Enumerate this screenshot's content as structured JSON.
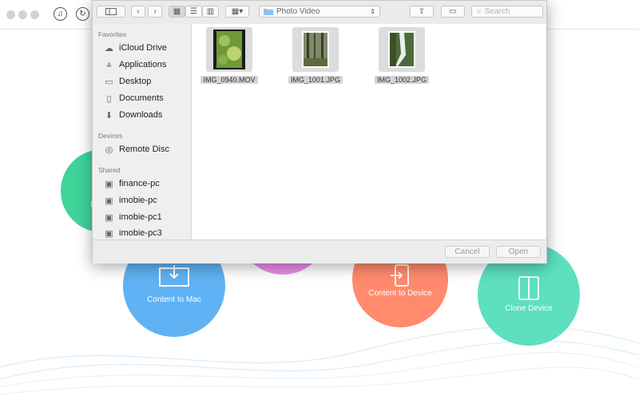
{
  "dialog": {
    "location": "Photo Video",
    "search_placeholder": "Search",
    "sections": {
      "favorites": "Favorites",
      "devices": "Devices",
      "shared": "Shared"
    },
    "favorites": [
      "iCloud Drive",
      "Applications",
      "Desktop",
      "Documents",
      "Downloads"
    ],
    "devices": [
      "Remote Disc"
    ],
    "shared": [
      "finance-pc",
      "imobie-pc",
      "imobie-pc1",
      "imobie-pc3"
    ],
    "files": [
      "IMG_0940.MOV",
      "IMG_1001.JPG",
      "IMG_1002.JPG"
    ],
    "cancel_label": "Cancel",
    "open_label": "Open"
  },
  "background": {
    "circles": {
      "content_to_mac": "Content to Mac",
      "content_to_device": "Content to Device",
      "clone_device": "Clone Device",
      "partial_left": "Men"
    }
  },
  "colors": {
    "green": "#3fd39a",
    "blue": "#5fb2f3",
    "orange": "#ff8a6d",
    "teal": "#5ddfc0",
    "pink": "#e98be8"
  }
}
